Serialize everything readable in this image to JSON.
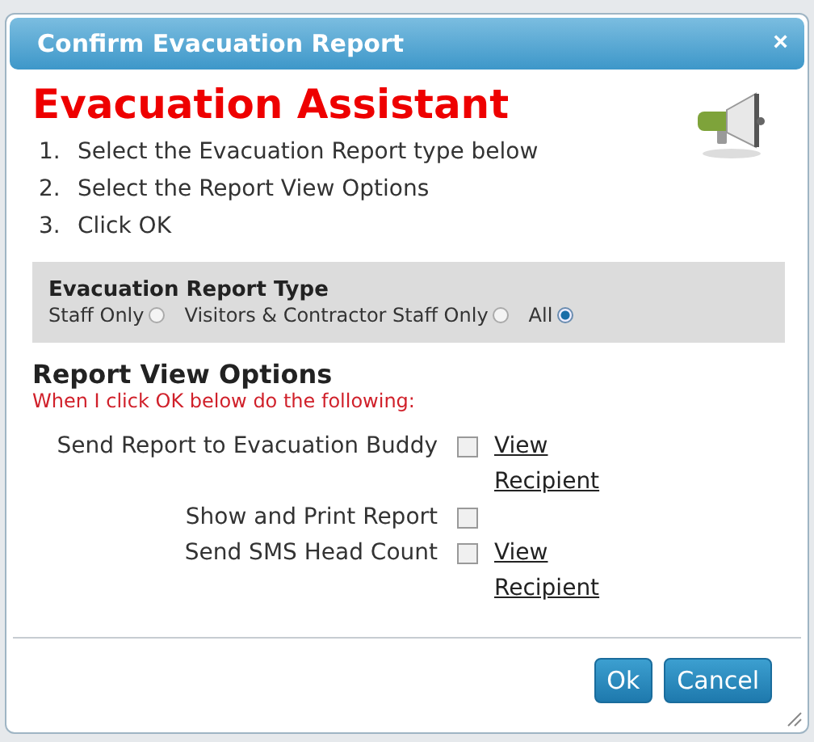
{
  "dialog": {
    "title": "Confirm Evacuation Report",
    "close": "×"
  },
  "heading": "Evacuation Assistant",
  "steps": [
    {
      "number": "1.",
      "text": "Select the Evacuation Report type below"
    },
    {
      "number": "2.",
      "text": "Select the Report View Options"
    },
    {
      "number": "3.",
      "text": "Click OK"
    }
  ],
  "report_type": {
    "title": "Evacuation Report Type",
    "options": [
      {
        "label": "Staff Only",
        "selected": false
      },
      {
        "label": "Visitors & Contractor Staff Only",
        "selected": false
      },
      {
        "label": "All",
        "selected": true
      }
    ]
  },
  "view_options": {
    "title": "Report View Options",
    "subtitle": "When I click OK below do the following:",
    "rows": [
      {
        "label": "Send Report to Evacuation Buddy",
        "checked": false,
        "link": "View Recipient"
      },
      {
        "label": "Show and Print Report",
        "checked": false
      },
      {
        "label": "Send SMS Head Count",
        "checked": false,
        "link": "View Recipient"
      }
    ]
  },
  "buttons": [
    "Ok",
    "Cancel"
  ]
}
